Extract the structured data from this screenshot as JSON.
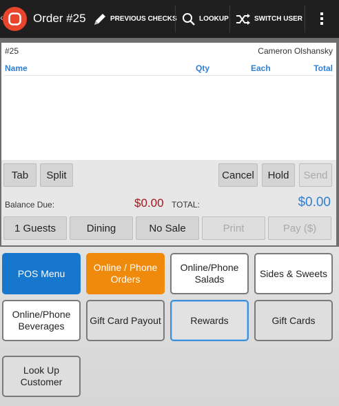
{
  "topbar": {
    "order_title": "Order #25",
    "previous_checks": "PREVIOUS CHECKS",
    "lookup": "LOOKUP",
    "switch_user": "SWITCH USER"
  },
  "check": {
    "number": "#25",
    "customer": "Cameron Olshansky",
    "columns": {
      "name": "Name",
      "qty": "Qty",
      "each": "Each",
      "total": "Total"
    }
  },
  "actions": {
    "tab": "Tab",
    "split": "Split",
    "cancel": "Cancel",
    "hold": "Hold",
    "send": "Send",
    "balance_label": "Balance Due:",
    "balance_value": "$0.00",
    "total_label": "TOTAL:",
    "total_value": "$0.00",
    "guests": "1 Guests",
    "dining": "Dining",
    "no_sale": "No Sale",
    "print": "Print",
    "pay": "Pay ($)"
  },
  "menu": {
    "pos_menu": "POS Menu",
    "online_phone_orders": "Online / Phone Orders",
    "online_phone_salads": "Online/Phone Salads",
    "sides_sweets": "Sides & Sweets",
    "online_phone_beverages": "Online/Phone Beverages",
    "gift_card_payout": "Gift Card Payout",
    "rewards": "Rewards",
    "gift_cards": "Gift Cards",
    "look_up_customer": "Look Up Customer"
  },
  "colors": {
    "accent_blue": "#1677cc",
    "accent_orange": "#f08a0c",
    "balance_red": "#a2161d",
    "logo_red": "#e8452c"
  },
  "icons": [
    "chevron-left-icon",
    "app-logo-icon",
    "pencil-icon",
    "search-icon",
    "shuffle-icon",
    "overflow-menu-icon"
  ]
}
